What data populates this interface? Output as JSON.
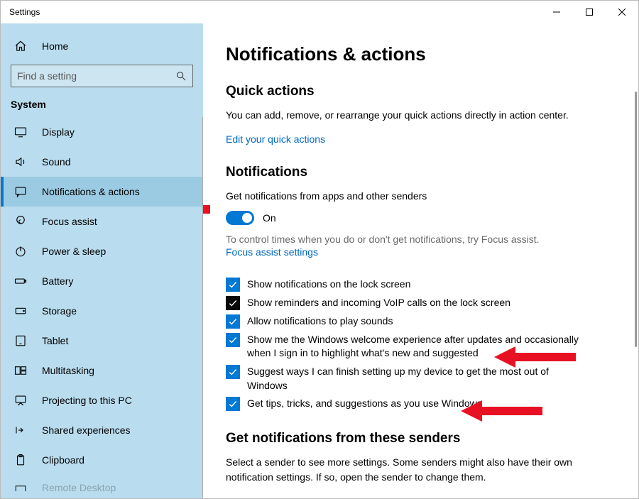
{
  "titlebar": {
    "title": "Settings"
  },
  "sidebar": {
    "home": "Home",
    "search_placeholder": "Find a setting",
    "category": "System",
    "items": [
      {
        "label": "Display"
      },
      {
        "label": "Sound"
      },
      {
        "label": "Notifications & actions"
      },
      {
        "label": "Focus assist"
      },
      {
        "label": "Power & sleep"
      },
      {
        "label": "Battery"
      },
      {
        "label": "Storage"
      },
      {
        "label": "Tablet"
      },
      {
        "label": "Multitasking"
      },
      {
        "label": "Projecting to this PC"
      },
      {
        "label": "Shared experiences"
      },
      {
        "label": "Clipboard"
      }
    ],
    "cutoff_label": "Remote Desktop"
  },
  "page": {
    "title": "Notifications & actions",
    "quick_actions": {
      "heading": "Quick actions",
      "body": "You can add, remove, or rearrange your quick actions directly in action center.",
      "link": "Edit your quick actions"
    },
    "notifications": {
      "heading": "Notifications",
      "toggle_label": "Get notifications from apps and other senders",
      "toggle_state": "On",
      "focus_hint": "To control times when you do or don't get notifications, try Focus assist.",
      "focus_link": "Focus assist settings",
      "checks": [
        "Show notifications on the lock screen",
        "Show reminders and incoming VoIP calls on the lock screen",
        "Allow notifications to play sounds",
        "Show me the Windows welcome experience after updates and occasionally when I sign in to highlight what's new and suggested",
        "Suggest ways I can finish setting up my device to get the most out of Windows",
        "Get tips, tricks, and suggestions as you use Windows"
      ]
    },
    "senders": {
      "heading": "Get notifications from these senders",
      "body": "Select a sender to see more settings. Some senders might also have their own notification settings. If so, open the sender to change them."
    }
  }
}
